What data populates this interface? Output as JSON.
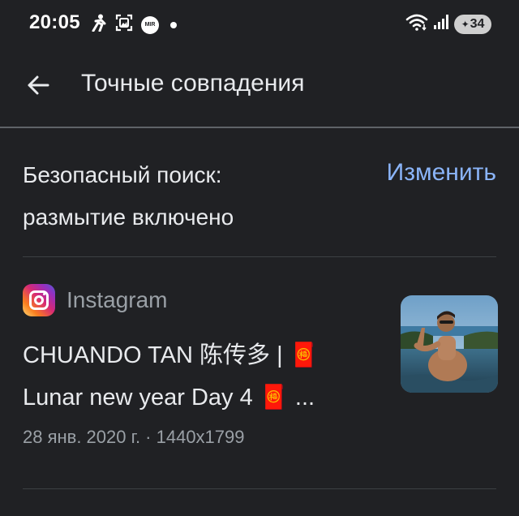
{
  "status_bar": {
    "time": "20:05",
    "mir_label": "MIR",
    "battery": "34",
    "icons_left": [
      "person-icon",
      "photo-frame-icon",
      "mir-pay-icon",
      "notification-dot-icon"
    ],
    "icons_right": [
      "wifi-icon",
      "signal-icon",
      "battery-icon"
    ]
  },
  "app_bar": {
    "title": "Точные совпадения",
    "back_icon": "arrow-back-icon"
  },
  "safesearch": {
    "text": "Безопасный поиск: размытие включено",
    "action": "Изменить"
  },
  "result": {
    "source": "Instagram",
    "source_icon": "instagram-icon",
    "title_text": "CHUANDO TAN 陈传多 | 🧧 Lunar new year Day 4 🧧 ...",
    "meta": "28 янв. 2020 г. · 1440x1799",
    "thumbnail_icon": "photo-thumbnail"
  },
  "colors": {
    "background": "#202124",
    "text_primary": "#e8eaed",
    "text_secondary": "#9aa0a6",
    "link": "#8ab4f8",
    "divider": "#3c4043"
  }
}
